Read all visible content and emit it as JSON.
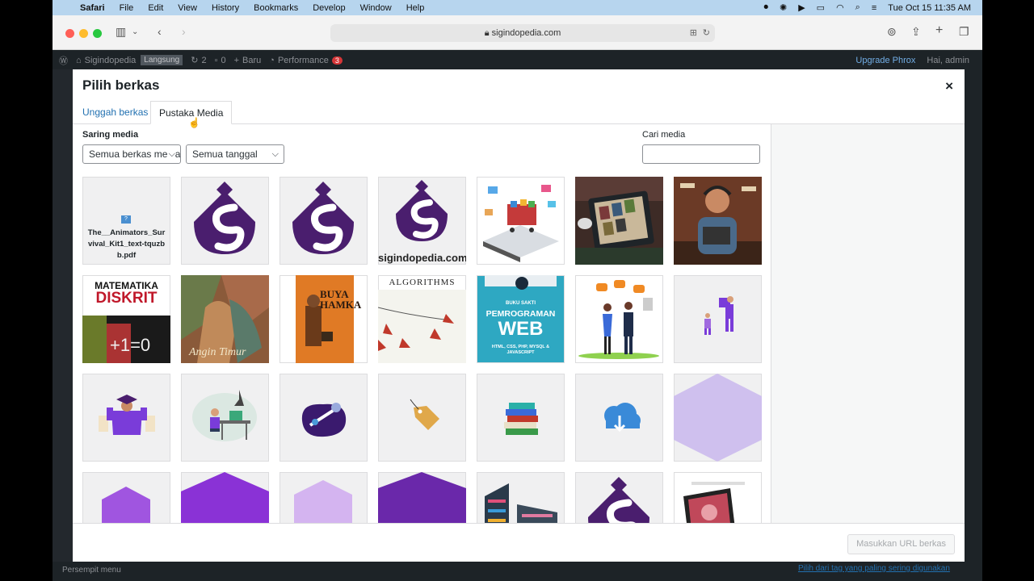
{
  "menubar": {
    "app": "Safari",
    "items": [
      "File",
      "Edit",
      "View",
      "History",
      "Bookmarks",
      "Develop",
      "Window",
      "Help"
    ],
    "clock": "Tue Oct 15  11:35 AM"
  },
  "browser": {
    "url": "sigindopedia.com"
  },
  "adminbar": {
    "site": "Sigindopedia",
    "status": "Langsung",
    "updates": "2",
    "comments": "0",
    "new_label": "Baru",
    "performance": "Performance",
    "performance_badge": "3",
    "upgrade": "Upgrade Phrox",
    "greeting": "Hai, admin"
  },
  "modal": {
    "title": "Pilih berkas",
    "close": "×",
    "tabs": [
      "Unggah berkas",
      "Pustaka Media"
    ],
    "filter_label": "Saring media",
    "filter_type": "Semua berkas media",
    "filter_date": "Semua tanggal",
    "search_label": "Cari media",
    "search_value": "",
    "insert_url_button": "Masukkan URL berkas"
  },
  "media": {
    "doc_name": "The__Animators_Survival_Kit1_text-tquzbb.pdf",
    "logo_caption": "sigindopedia.com",
    "book1_title_1": "MATEMATIKA",
    "book1_title_2": "DISKRIT",
    "book1_formula": "+1=0",
    "book2_caption": "Angin Timur",
    "book3_title_1": "BUYA",
    "book3_title_2": "HAMKA",
    "book4_title": "ALGORITHMS",
    "book5_small": "BUKU SAKTI",
    "book5_title_1": "PEMROGRAMAN",
    "book5_title_2": "WEB",
    "book5_sub": "HTML, CSS, PHP, MYSQL & JAVASCRIPT"
  },
  "bottom": {
    "collapse": "Persempit menu",
    "link": "Pilih dari tag yang paling sering digunakan"
  },
  "colors": {
    "brand_purple": "#4a1e6e",
    "accent_purple": "#8a3cd9",
    "link_blue": "#2271b1"
  }
}
